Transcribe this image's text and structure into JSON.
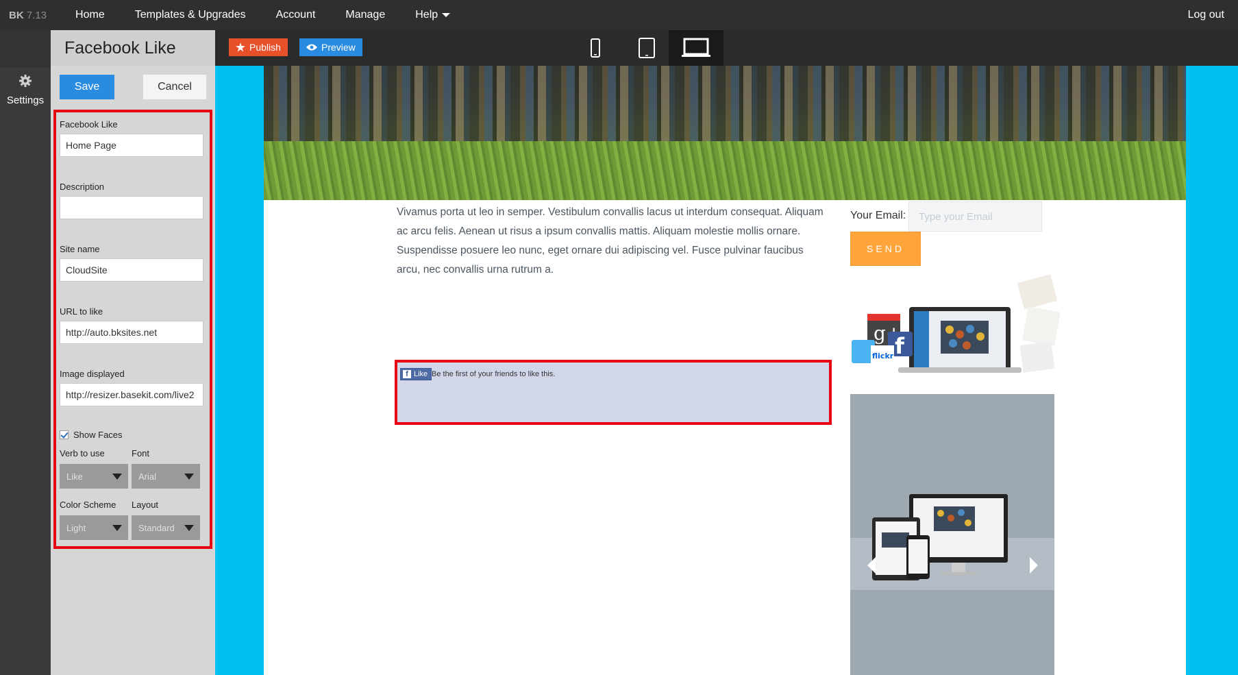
{
  "topnav": {
    "brand_logo": "BK",
    "brand_version": "7.13",
    "items": [
      "Home",
      "Templates & Upgrades",
      "Account",
      "Manage",
      "Help"
    ],
    "logout": "Log out"
  },
  "rail": {
    "settings_label": "Settings",
    "settings_icon": "gear-icon"
  },
  "panel": {
    "title": "Facebook Like",
    "save_label": "Save",
    "cancel_label": "Cancel",
    "fields": {
      "facebook_like_label": "Facebook Like",
      "facebook_like_value": "Home Page",
      "description_label": "Description",
      "description_value": "",
      "site_name_label": "Site name",
      "site_name_value": "CloudSite",
      "url_label": "URL to like",
      "url_value": "http://auto.bksites.net",
      "image_label": "Image displayed",
      "image_value": "http://resizer.basekit.com/live2"
    },
    "show_faces_label": "Show Faces",
    "selects": {
      "verb_label": "Verb to use",
      "verb_value": "Like",
      "font_label": "Font",
      "font_value": "Arial",
      "color_label": "Color Scheme",
      "color_value": "Light",
      "layout_label": "Layout",
      "layout_value": "Standard"
    }
  },
  "toolbar": {
    "publish_label": "Publish",
    "preview_label": "Preview"
  },
  "page": {
    "body_text": "Vivamus porta ut leo in semper. Vestibulum convallis lacus ut interdum consequat. Aliquam ac arcu felis. Aenean ut risus a ipsum convallis mattis. Aliquam molestie mollis ornare. Suspendisse posuere leo nunc, eget ornare dui adipiscing vel. Fusce pulvinar faucibus arcu, nec convallis urna rutrum a.",
    "email_label": "Your Email:",
    "email_placeholder": "Type your Email",
    "send_label": "SEND",
    "fb_like_button": "Like",
    "fb_like_text": "Be the first of your friends to like this."
  },
  "colors": {
    "canvas_bg": "#00bff3",
    "publish": "#e8502a",
    "preview": "#2a8ce0",
    "send": "#ffa53b",
    "highlight": "#e60012"
  }
}
